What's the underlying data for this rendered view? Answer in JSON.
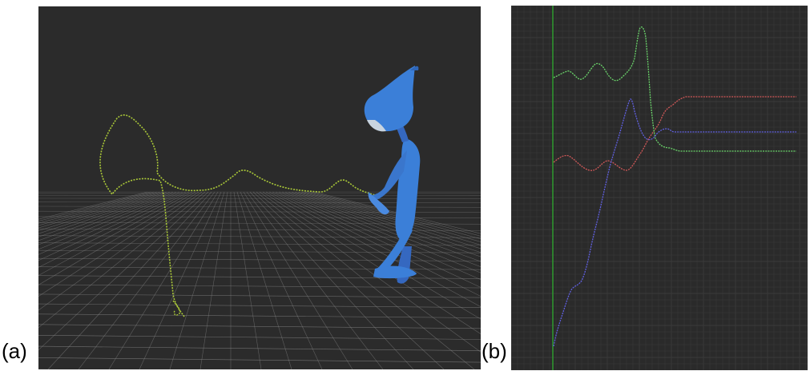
{
  "figure": {
    "panels": [
      {
        "id": "a",
        "label": "(a)",
        "view": "3d-viewport"
      },
      {
        "id": "b",
        "label": "(b)",
        "view": "graph-editor"
      }
    ]
  },
  "viewport": {
    "background": "#2b2b2b",
    "grid_color": "#8a8a8a",
    "character_color": "#3b7fd8",
    "motion_path_color": "#b8d93a"
  },
  "graph_editor": {
    "background": "#2a2a2a",
    "grid_color": "#3a3a3a",
    "time_cursor_color": "#2e9a2e",
    "curves": [
      {
        "channel": "x",
        "color": "#d05858"
      },
      {
        "channel": "y",
        "color": "#6ad36a"
      },
      {
        "channel": "z",
        "color": "#6060e0"
      }
    ]
  }
}
